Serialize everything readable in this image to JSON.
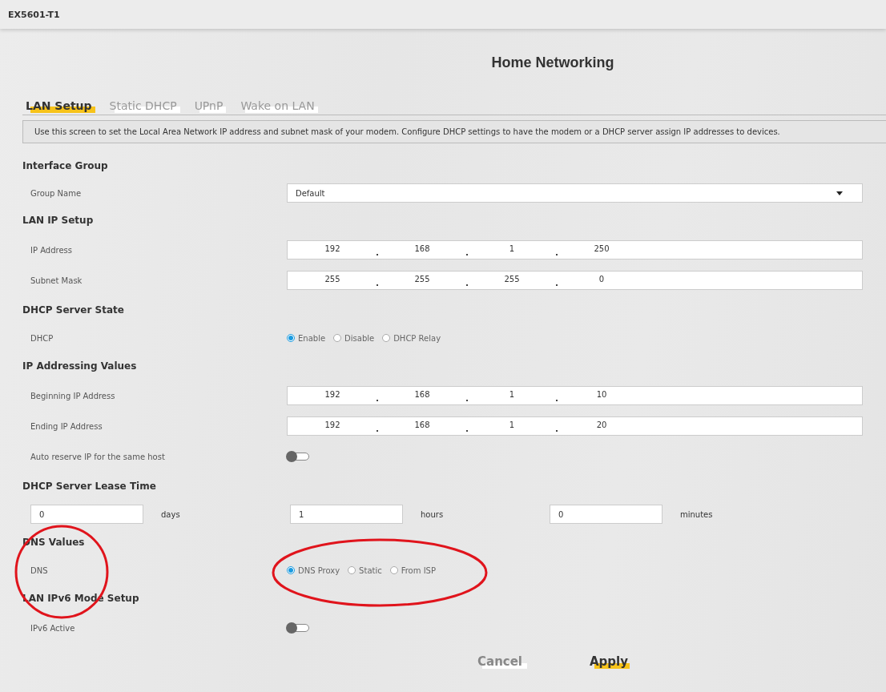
{
  "header": {
    "device": "EX5601-T1"
  },
  "page": {
    "title": "Home Networking"
  },
  "tabs": [
    {
      "label": "LAN Setup",
      "selected": true
    },
    {
      "label": "Static DHCP",
      "selected": false
    },
    {
      "label": "UPnP",
      "selected": false
    },
    {
      "label": "Wake on LAN",
      "selected": false
    }
  ],
  "description": "Use this screen to set the Local Area Network IP address and subnet mask of your modem. Configure DHCP settings to have the modem or a DHCP server assign IP addresses to devices.",
  "sections": [
    {
      "heading": "Interface Group",
      "rows": [
        {
          "kind": "select",
          "label": "Group Name",
          "value": "Default"
        }
      ]
    },
    {
      "heading": "LAN IP Setup",
      "rows": [
        {
          "kind": "ip",
          "label": "IP Address",
          "octets": [
            "192",
            "168",
            "1",
            "250"
          ]
        },
        {
          "kind": "ip",
          "label": "Subnet Mask",
          "octets": [
            "255",
            "255",
            "255",
            "0"
          ]
        }
      ]
    },
    {
      "heading": "DHCP Server State",
      "rows": [
        {
          "kind": "radio",
          "label": "DHCP",
          "options": [
            {
              "label": "Enable",
              "selected": true
            },
            {
              "label": "Disable",
              "selected": false
            },
            {
              "label": "DHCP Relay",
              "selected": false
            }
          ]
        }
      ]
    },
    {
      "heading": "IP Addressing Values",
      "rows": [
        {
          "kind": "ip",
          "label": "Beginning IP Address",
          "octets": [
            "192",
            "168",
            "1",
            "10"
          ]
        },
        {
          "kind": "ip",
          "label": "Ending IP Address",
          "octets": [
            "192",
            "168",
            "1",
            "20"
          ]
        },
        {
          "kind": "toggle",
          "label": "Auto reserve IP for the same host",
          "on": false
        }
      ]
    },
    {
      "heading": "DHCP Server Lease Time",
      "rows": [
        {
          "kind": "lease",
          "fields": [
            {
              "value": "0",
              "unit": "days"
            },
            {
              "value": "1",
              "unit": "hours"
            },
            {
              "value": "0",
              "unit": "minutes"
            }
          ]
        }
      ]
    },
    {
      "heading": "DNS Values",
      "rows": [
        {
          "kind": "radio",
          "label": "DNS",
          "options": [
            {
              "label": "DNS Proxy",
              "selected": true
            },
            {
              "label": "Static",
              "selected": false
            },
            {
              "label": "From ISP",
              "selected": false
            }
          ]
        }
      ]
    },
    {
      "heading": "LAN IPv6 Mode Setup",
      "rows": [
        {
          "kind": "toggle",
          "label": "IPv6 Active",
          "on": false
        }
      ]
    }
  ],
  "buttons": [
    {
      "label": "Cancel",
      "kind": "secondary"
    },
    {
      "label": "Apply",
      "kind": "primary"
    }
  ]
}
